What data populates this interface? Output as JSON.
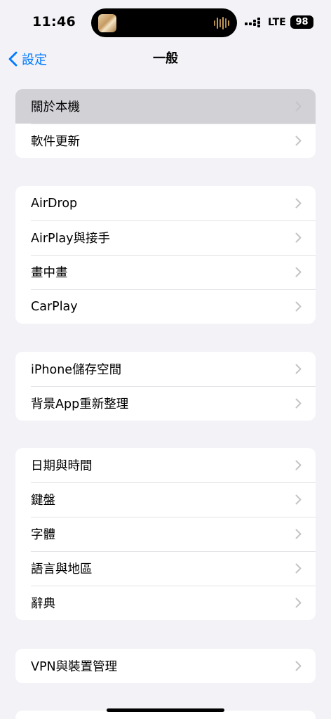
{
  "status_bar": {
    "time": "11:46",
    "network": "LTE",
    "battery": "98"
  },
  "nav": {
    "back_label": "設定",
    "title": "一般"
  },
  "groups": [
    {
      "rows": [
        "關於本機",
        "軟件更新"
      ]
    },
    {
      "rows": [
        "AirDrop",
        "AirPlay與接手",
        "畫中畫",
        "CarPlay"
      ]
    },
    {
      "rows": [
        "iPhone儲存空間",
        "背景App重新整理"
      ]
    },
    {
      "rows": [
        "日期與時間",
        "鍵盤",
        "字體",
        "語言與地區",
        "辭典"
      ]
    },
    {
      "rows": [
        "VPN與裝置管理"
      ]
    }
  ],
  "colors": {
    "accent": "#007aff",
    "background": "#f2f2f7",
    "highlight": "#d1d1d6",
    "chevron": "#c4c4c7"
  },
  "icons": {
    "back": "chevron-left-icon",
    "row_disclosure": "chevron-right-icon",
    "signal": "cellular-signal-icon",
    "battery": "battery-icon",
    "now_playing": "audio-waveform-icon"
  }
}
